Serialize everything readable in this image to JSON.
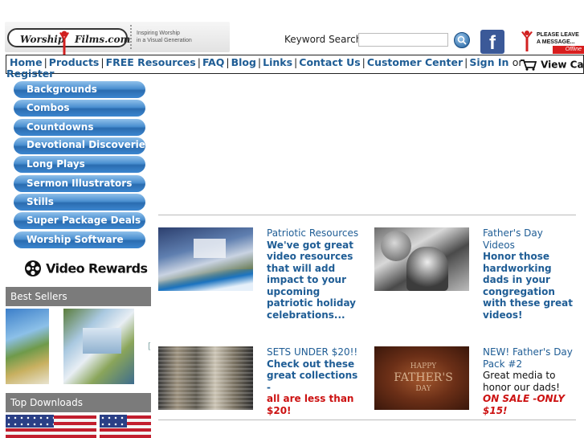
{
  "header": {
    "logo_left": "Worship",
    "logo_right": "Films.com",
    "tagline_1": "Inspiring Worship",
    "tagline_2": "in a Visual Generation",
    "keyword_label": "Keyword Search",
    "keyword_value": "",
    "facebook_letter": "f",
    "leave_message_1": "PLEASE LEAVE",
    "leave_message_2": "A MESSAGE...",
    "chat_status": "Offline"
  },
  "nav": {
    "items": [
      "Home",
      "Products",
      "FREE Resources",
      "FAQ",
      "Blog",
      "Links",
      "Contact Us",
      "Customer Center",
      "Sign In"
    ],
    "or_text": "or",
    "register": "Register",
    "cart": "View Cart"
  },
  "sidebar": {
    "categories": [
      "Backgrounds",
      "Combos",
      "Countdowns",
      "Devotional Discoveries",
      "Long Plays",
      "Sermon Illustrators",
      "Stills",
      "Super Package Deals",
      "Worship Software"
    ],
    "rewards": "Video Rewards",
    "best_sellers": "Best Sellers",
    "top_downloads": "Top Downloads"
  },
  "features": [
    {
      "title": "Patriotic Resources",
      "desc": "We've got great video resources that will add impact to your upcoming patriotic holiday celebrations..."
    },
    {
      "title": "Father's Day Videos",
      "desc": "Honor those hardworking dads in your congregation with these great videos!"
    },
    {
      "title": "SETS UNDER $20!!",
      "desc": "Check out these great collections -",
      "desc_red": "all are less than $20!"
    },
    {
      "title": "NEW! Father's Day Pack #2",
      "desc": "Great media to honor our dads!",
      "desc_red": "ON SALE -ONLY $15!",
      "image_text_1": "HAPPY",
      "image_text_2": "FATHER'S",
      "image_text_3": "DAY"
    }
  ],
  "colors": {
    "link": "#1f5d95",
    "button_blue": "#2a6cb0",
    "sale_red": "#cc1111",
    "side_head_gray": "#7b7b7b"
  }
}
